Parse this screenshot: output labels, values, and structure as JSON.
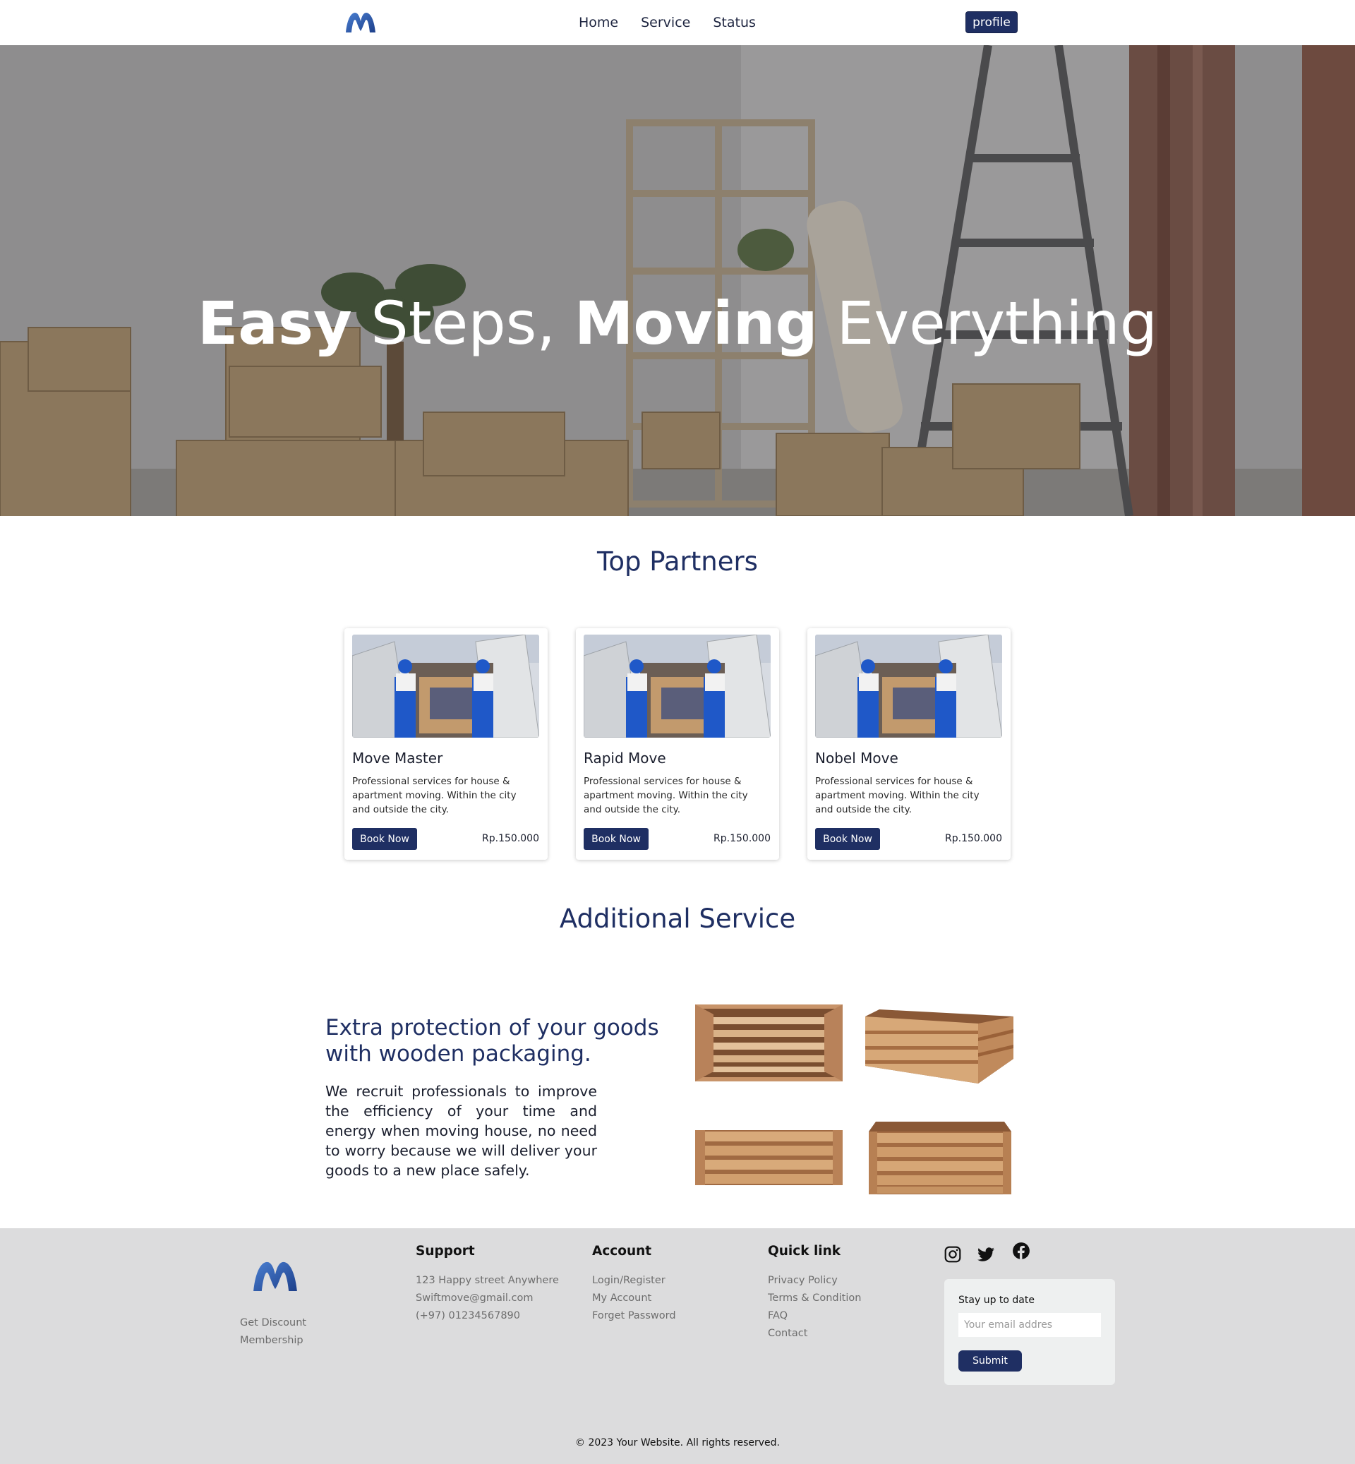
{
  "nav": {
    "logo": "m-logo-icon",
    "links": [
      "Home",
      "Service",
      "Status"
    ],
    "profile_label": "profile"
  },
  "hero": {
    "word1": "Easy",
    "word2": "Steps,",
    "word3": "Moving",
    "word4": "Everything"
  },
  "partners": {
    "title": "Top Partners",
    "cards": [
      {
        "name": "Move Master",
        "description": "Professional services for house & apartment moving. Within the city and outside the city.",
        "button": "Book Now",
        "price": "Rp.150.000"
      },
      {
        "name": "Rapid Move",
        "description": "Professional services for house & apartment moving. Within the city and outside the city.",
        "button": "Book Now",
        "price": "Rp.150.000"
      },
      {
        "name": "Nobel Move",
        "description": "Professional services for house & apartment moving. Within the city and outside the city.",
        "button": "Book Now",
        "price": "Rp.150.000"
      }
    ]
  },
  "additional": {
    "title": "Additional Service",
    "heading": "Extra protection of your goods with wooden packaging.",
    "text": "We recruit professionals to improve the efficiency of your time and energy when moving house, no need to worry because we will deliver your goods to a new place safely."
  },
  "footer": {
    "left_links": [
      "Get Discount",
      "Membership"
    ],
    "support": {
      "title": "Support",
      "items": [
        "123 Happy street Anywhere",
        "Swiftmove@gmail.com",
        "(+97) 01234567890"
      ]
    },
    "account": {
      "title": "Account",
      "items": [
        "Login/Register",
        "My Account",
        "Forget Password"
      ]
    },
    "quicklink": {
      "title": "Quick link",
      "items": [
        "Privacy Policy",
        "Terms & Condition",
        "FAQ",
        "Contact"
      ]
    },
    "social": [
      "instagram-icon",
      "twitter-icon",
      "facebook-icon"
    ],
    "newsletter": {
      "title": "Stay up to date",
      "placeholder": "Your email addres",
      "button": "Submit"
    },
    "copyright": "© 2023 Your Website. All rights reserved."
  },
  "colors": {
    "brand": "#1f2f63",
    "footer_bg": "#dcdcdd"
  }
}
